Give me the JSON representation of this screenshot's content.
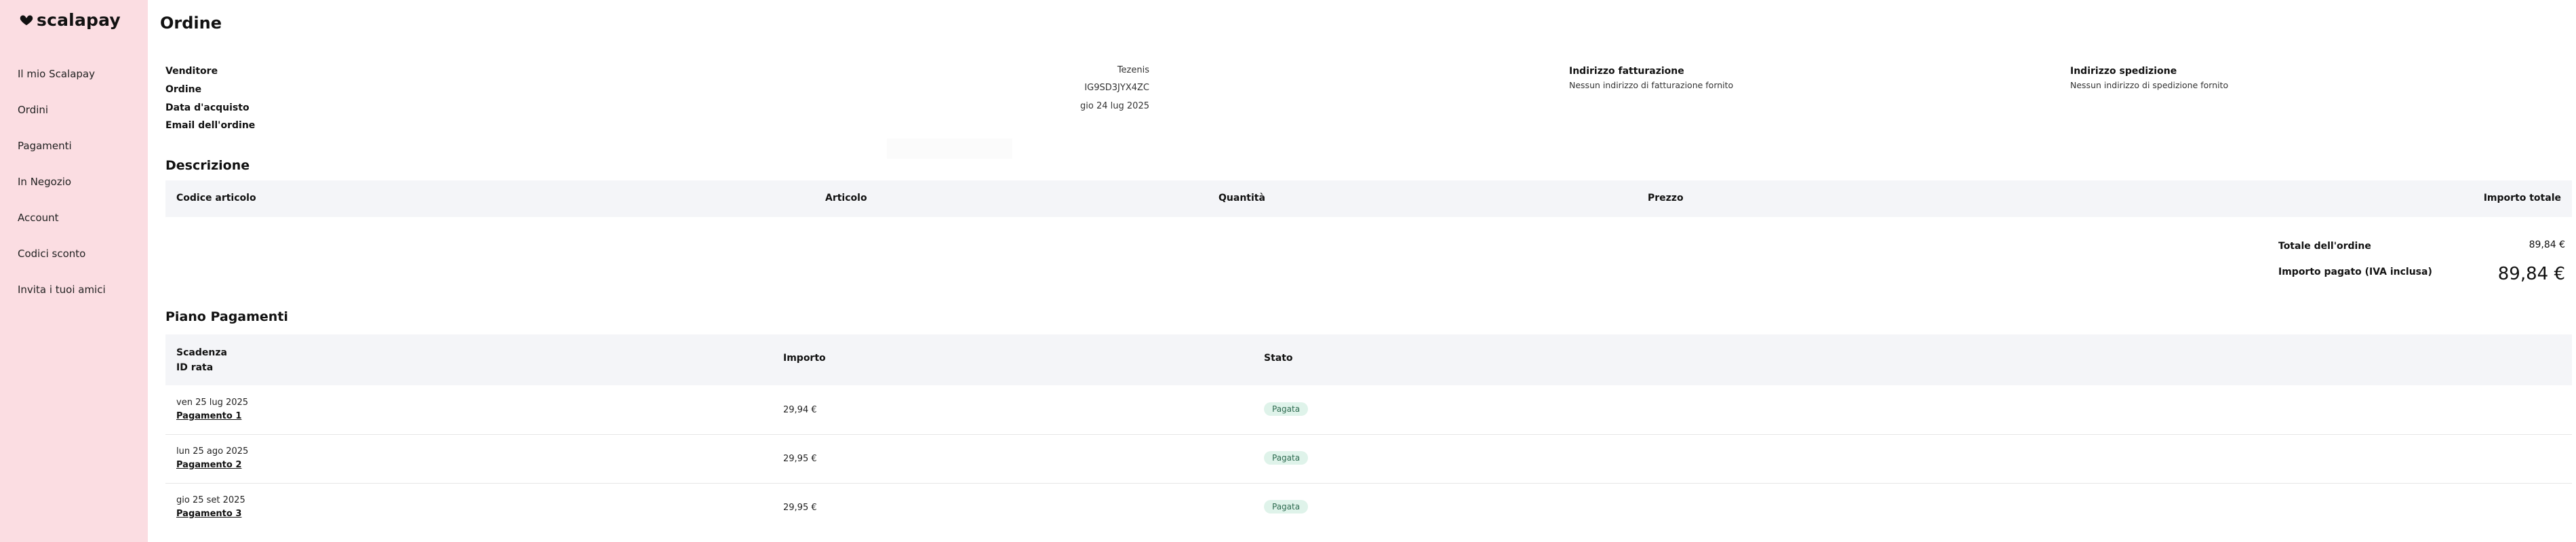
{
  "brand": {
    "name": "scalapay",
    "accent": "#fbdde2"
  },
  "sidebar": {
    "items": [
      {
        "label": "Il mio Scalapay"
      },
      {
        "label": "Ordini"
      },
      {
        "label": "Pagamenti"
      },
      {
        "label": "In Negozio"
      },
      {
        "label": "Account"
      },
      {
        "label": "Codici sconto"
      },
      {
        "label": "Invita i tuoi amici"
      }
    ]
  },
  "page": {
    "title": "Ordine"
  },
  "order": {
    "labels": {
      "seller": "Venditore",
      "order": "Ordine",
      "date": "Data d'acquisto",
      "email": "Email dell'ordine"
    },
    "values": {
      "seller": "Tezenis",
      "order": "IG9SD3JYX4ZC",
      "date": "gio 24 lug 2025"
    }
  },
  "billing": {
    "label": "Indirizzo fatturazione",
    "value": "Nessun indirizzo di fatturazione fornito"
  },
  "shipping": {
    "label": "Indirizzo spedizione",
    "value": "Nessun indirizzo di spedizione fornito"
  },
  "description": {
    "title": "Descrizione",
    "columns": [
      "Codice articolo",
      "Articolo",
      "Quantità",
      "Prezzo",
      "Importo totale"
    ]
  },
  "totals": {
    "order_total_label": "Totale dell'ordine",
    "order_total_value": "89,84 €",
    "paid_label": "Importo pagato (IVA inclusa)",
    "paid_value": "89,84 €"
  },
  "plan": {
    "title": "Piano Pagamenti",
    "columns": {
      "due": "Scadenza",
      "id": "ID rata",
      "amount": "Importo",
      "status": "Stato"
    },
    "rows": [
      {
        "date": "ven 25 lug 2025",
        "link": "Pagamento 1",
        "amount": "29,94 €",
        "status": "Pagata"
      },
      {
        "date": "lun 25 ago 2025",
        "link": "Pagamento 2",
        "amount": "29,95 €",
        "status": "Pagata"
      },
      {
        "date": "gio 25 set 2025",
        "link": "Pagamento 3",
        "amount": "29,95 €",
        "status": "Pagata"
      }
    ]
  }
}
